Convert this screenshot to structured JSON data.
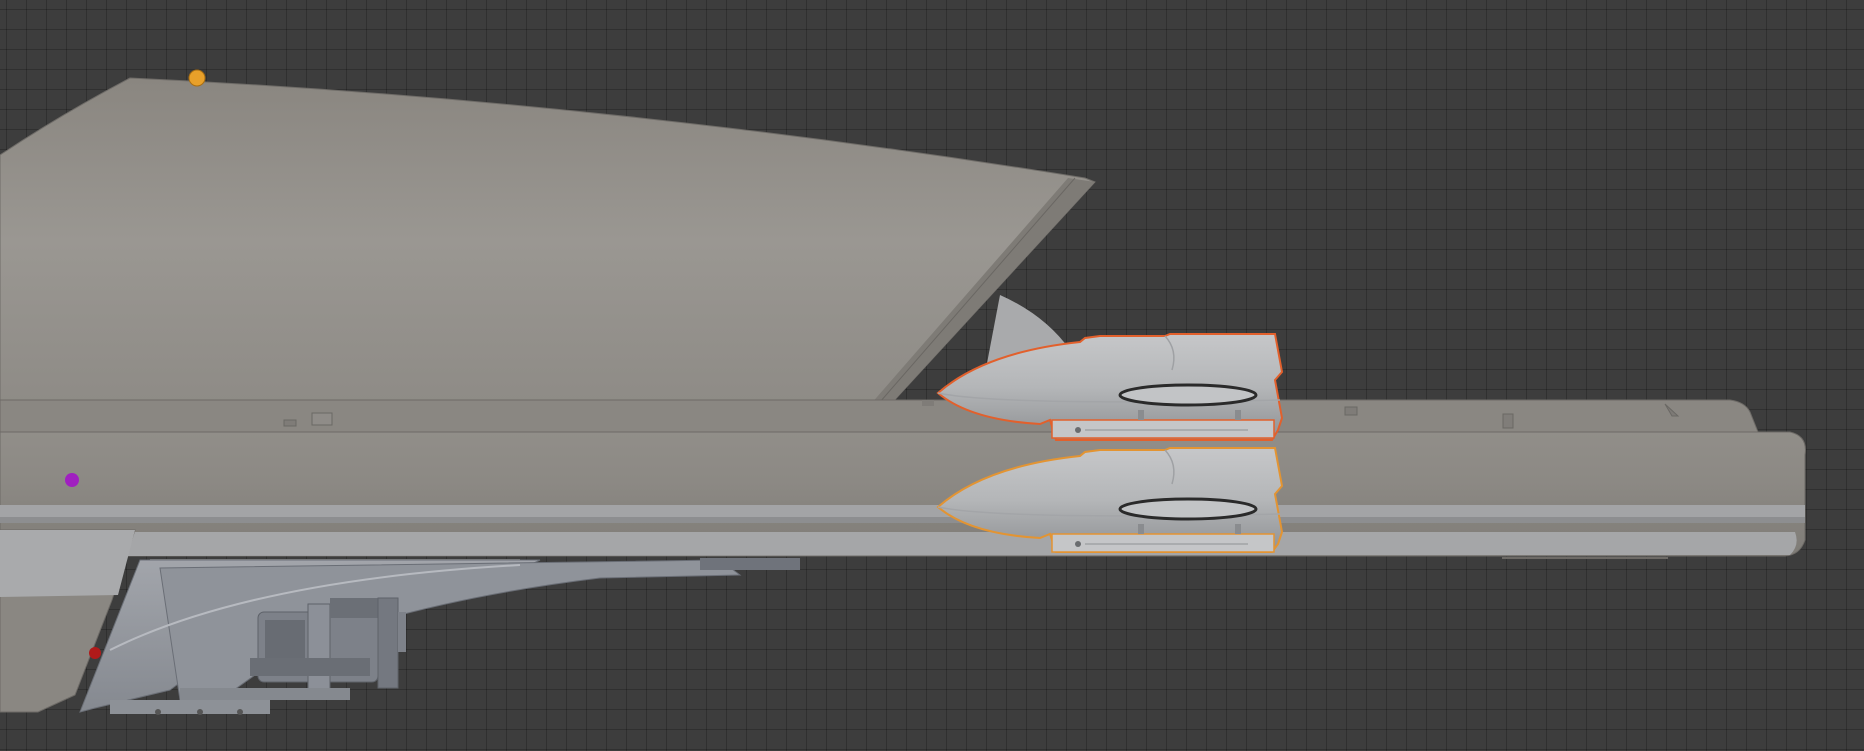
{
  "viewport": {
    "name": "3D Viewport",
    "background": "#3d3d3d",
    "grid_color": "#333333"
  },
  "colors": {
    "hull": "#8d8a85",
    "hull_light": "#9b9893",
    "hull_dark": "#75726d",
    "mechanical": "#9599a0",
    "pod_fill": "#b7b9bb",
    "pod_shadow": "#8c8e91",
    "selection_active": "#e2602c",
    "selection": "#e39432",
    "amber_light": "#e8a02a",
    "purple_marker": "#a020c0",
    "red_marker": "#b01a1a"
  },
  "objects": [
    {
      "name": "hull",
      "selected": false
    },
    {
      "name": "upper-engine-pod",
      "selected": true,
      "active": true
    },
    {
      "name": "lower-engine-pod",
      "selected": true,
      "active": false
    },
    {
      "name": "landing-gear",
      "selected": false
    }
  ]
}
